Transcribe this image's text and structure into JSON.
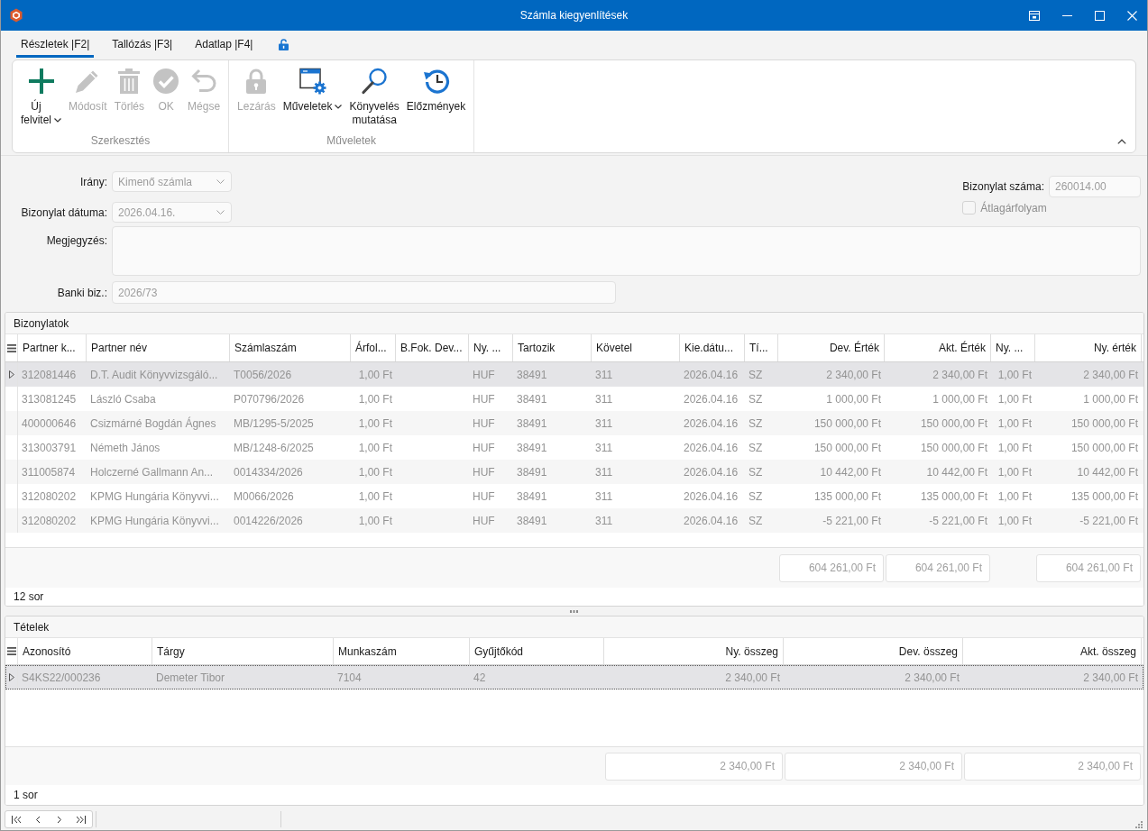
{
  "window": {
    "title": "Számla kiegyenlítések"
  },
  "tabs": [
    {
      "label": "Részletek |F2|",
      "selected": true
    },
    {
      "label": "Tallózás |F3|",
      "selected": false
    },
    {
      "label": "Adatlap |F4|",
      "selected": false
    }
  ],
  "ribbon": {
    "groups": [
      {
        "label": "Szerkesztés",
        "buttons": [
          {
            "label": "Új felvitel",
            "disabled": false,
            "dropdown": true
          },
          {
            "label": "Módosít",
            "disabled": true,
            "dropdown": false
          },
          {
            "label": "Törlés",
            "disabled": true,
            "dropdown": false
          },
          {
            "label": "OK",
            "disabled": true,
            "dropdown": false
          },
          {
            "label": "Mégse",
            "disabled": true,
            "dropdown": false
          }
        ]
      },
      {
        "label": "Műveletek",
        "buttons": [
          {
            "label": "Lezárás",
            "disabled": true,
            "dropdown": false
          },
          {
            "label": "Műveletek",
            "disabled": false,
            "dropdown": true
          },
          {
            "label": "Könyvelés mutatása",
            "disabled": false,
            "dropdown": false
          },
          {
            "label": "Előzmények",
            "disabled": false,
            "dropdown": false
          }
        ]
      }
    ]
  },
  "form": {
    "fields": [
      {
        "label": "Irány:",
        "kind": "combo",
        "value": "Kimenő számla"
      },
      {
        "label": "Bizonylat dátuma:",
        "kind": "combo",
        "value": "2026.04.16."
      },
      {
        "label": "Megjegyzés:",
        "kind": "memo"
      },
      {
        "label": "Banki biz.:",
        "kind": "text",
        "value": "2026/73"
      }
    ],
    "document_number": {
      "label": "Bizonylat száma:",
      "value": "260014.00"
    },
    "average_rate": {
      "label": "Átlagárfolyam",
      "checked": false,
      "disabled": true
    }
  },
  "documents": {
    "title": "Bizonylatok",
    "columns": [
      {
        "label": "Partner k...",
        "kind": "text"
      },
      {
        "label": "Partner név",
        "kind": "text"
      },
      {
        "label": "Számlaszám",
        "kind": "text"
      },
      {
        "label": "Árfol...",
        "kind": "rate"
      },
      {
        "label": "B.Fok. Dev...",
        "kind": "text"
      },
      {
        "label": "Ny. ...",
        "kind": "text"
      },
      {
        "label": "Tartozik",
        "kind": "text"
      },
      {
        "label": "Követel",
        "kind": "text"
      },
      {
        "label": "Kie.dátu...",
        "kind": "text"
      },
      {
        "label": "Tí...",
        "kind": "text"
      },
      {
        "label": "Dev. Érték",
        "kind": "amount",
        "total": "604 261,00 Ft"
      },
      {
        "label": "Akt. Érték",
        "kind": "amount",
        "total": "604 261,00 Ft"
      },
      {
        "label": "Ny. ...",
        "kind": "rate"
      },
      {
        "label": "Ny. érték",
        "kind": "amount",
        "total": "604 261,00 Ft"
      }
    ],
    "rows": [
      {
        "selected": true,
        "focused": false,
        "cells": [
          "312081446",
          "D.T. Audit Könyvvizsgáló...",
          "T0056/2026",
          "1,00 Ft",
          null,
          "HUF",
          "38491",
          "311",
          "2026.04.16",
          "SZ",
          "2 340,00 Ft",
          "2 340,00 Ft",
          "1,00 Ft",
          "2 340,00 Ft"
        ]
      },
      {
        "selected": false,
        "focused": false,
        "cells": [
          "313081245",
          "László Csaba",
          "P070796/2026",
          "1,00 Ft",
          null,
          "HUF",
          "38491",
          "311",
          "2026.04.16",
          "SZ",
          "1 000,00 Ft",
          "1 000,00 Ft",
          "1,00 Ft",
          "1 000,00 Ft"
        ]
      },
      {
        "selected": false,
        "focused": false,
        "cells": [
          "400000646",
          "Csizmárné Bogdán Ágnes",
          "MB/1295-5/2025",
          "1,00 Ft",
          null,
          "HUF",
          "38491",
          "311",
          "2026.04.16",
          "SZ",
          "150 000,00 Ft",
          "150 000,00 Ft",
          "1,00 Ft",
          "150 000,00 Ft"
        ]
      },
      {
        "selected": false,
        "focused": false,
        "cells": [
          "313003791",
          "Németh János",
          "MB/1248-6/2025",
          "1,00 Ft",
          null,
          "HUF",
          "38491",
          "311",
          "2026.04.16",
          "SZ",
          "150 000,00 Ft",
          "150 000,00 Ft",
          "1,00 Ft",
          "150 000,00 Ft"
        ]
      },
      {
        "selected": false,
        "focused": false,
        "cells": [
          "311005874",
          "Holczerné Gallmann An...",
          "0014334/2026",
          "1,00 Ft",
          null,
          "HUF",
          "38491",
          "311",
          "2026.04.16",
          "SZ",
          "10 442,00 Ft",
          "10 442,00 Ft",
          "1,00 Ft",
          "10 442,00 Ft"
        ]
      },
      {
        "selected": false,
        "focused": false,
        "cells": [
          "312080202",
          "KPMG Hungária Könyvvi...",
          "M0066/2026",
          "1,00 Ft",
          null,
          "HUF",
          "38491",
          "311",
          "2026.04.16",
          "SZ",
          "135 000,00 Ft",
          "135 000,00 Ft",
          "1,00 Ft",
          "135 000,00 Ft"
        ]
      },
      {
        "selected": false,
        "focused": false,
        "cells": [
          "312080202",
          "KPMG Hungária Könyvvi...",
          "0014226/2026",
          "1,00 Ft",
          null,
          "HUF",
          "38491",
          "311",
          "2026.04.16",
          "SZ",
          "-5 221,00 Ft",
          "-5 221,00 Ft",
          "1,00 Ft",
          "-5 221,00 Ft"
        ]
      }
    ],
    "row_count": "12 sor"
  },
  "items": {
    "title": "Tételek",
    "columns": [
      {
        "label": "Azonosító",
        "kind": "text"
      },
      {
        "label": "Tárgy",
        "kind": "text"
      },
      {
        "label": "Munkaszám",
        "kind": "text"
      },
      {
        "label": "Gyűjtőkód",
        "kind": "text"
      },
      {
        "label": "Ny. összeg",
        "kind": "amount",
        "total": "2 340,00 Ft"
      },
      {
        "label": "Dev. összeg",
        "kind": "amount",
        "total": "2 340,00 Ft"
      },
      {
        "label": "Akt. összeg",
        "kind": "amount",
        "total": "2 340,00 Ft"
      }
    ],
    "rows": [
      {
        "selected": true,
        "focused": true,
        "cells": [
          "S4KS22/000236",
          "Demeter Tibor",
          "7104",
          "42",
          "2 340,00 Ft",
          "2 340,00 Ft",
          "2 340,00 Ft"
        ]
      }
    ],
    "row_count": "1 sor"
  }
}
